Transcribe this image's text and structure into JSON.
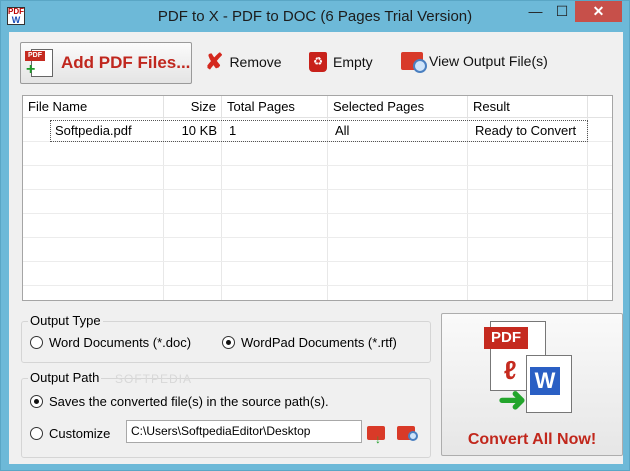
{
  "window": {
    "title": "PDF to X - PDF to DOC (6 Pages Trial Version)",
    "min_glyph": "—",
    "max_glyph": "☐",
    "close_glyph": "✕"
  },
  "toolbar": {
    "add_label": "Add PDF Files...",
    "remove_label": "Remove",
    "empty_label": "Empty",
    "view_label": "View Output File(s)"
  },
  "file_list": {
    "columns": [
      "File Name",
      "Size",
      "Total Pages",
      "Selected Pages",
      "Result"
    ],
    "rows": [
      {
        "name": "Softpedia.pdf",
        "size": "10 KB",
        "total_pages": "1",
        "selected_pages": "All",
        "result": "Ready to Convert"
      }
    ]
  },
  "output_type": {
    "title": "Output Type",
    "options": [
      {
        "label": "Word Documents (*.doc)",
        "selected": false
      },
      {
        "label": "WordPad Documents (*.rtf)",
        "selected": true
      }
    ]
  },
  "output_path": {
    "title": "Output Path",
    "options": [
      {
        "label": "Saves the converted file(s) in the source path(s).",
        "selected": true
      },
      {
        "label": "Customize",
        "selected": false
      }
    ],
    "path_value": "C:\\Users\\SoftpediaEditor\\Desktop"
  },
  "convert": {
    "label": "Convert All Now!",
    "art_pdf": "PDF",
    "art_word": "W"
  },
  "icons": {
    "app": "app-icon",
    "add": "add-pdf-icon",
    "remove": "red-x-icon",
    "empty": "recycle-bin-icon",
    "view": "folder-magnifier-icon"
  },
  "watermark": "SOFTPEDIA"
}
